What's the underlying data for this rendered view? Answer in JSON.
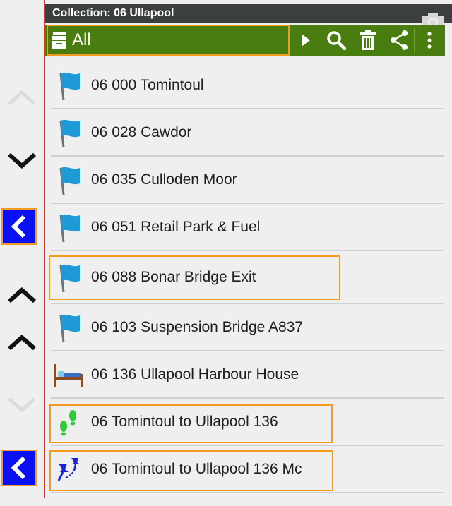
{
  "titlebar": {
    "title": "Collection: 06 Ullapool"
  },
  "toolbar": {
    "filter_label": "All",
    "icons": [
      "archive-icon",
      "play-icon",
      "search-icon",
      "trash-icon",
      "share-icon",
      "overflow-menu-icon"
    ]
  },
  "rail": {
    "buttons": [
      "chevron-up-icon",
      "chevron-down-icon",
      "chevron-left-icon",
      "chevron-up-icon",
      "chevron-up-icon",
      "chevron-down-icon",
      "chevron-left-icon"
    ]
  },
  "items": [
    {
      "label": "06 000 Tomintoul",
      "icon": "flag-icon"
    },
    {
      "label": "06 028 Cawdor",
      "icon": "flag-icon"
    },
    {
      "label": "06 035 Culloden Moor",
      "icon": "flag-icon"
    },
    {
      "label": "06 051 Retail Park & Fuel",
      "icon": "flag-icon"
    },
    {
      "label": "06 088 Bonar Bridge Exit",
      "icon": "flag-icon"
    },
    {
      "label": "06 103 Suspension Bridge A837",
      "icon": "flag-icon"
    },
    {
      "label": "06 136 Ullapool Harbour House",
      "icon": "bed-icon"
    },
    {
      "label": "06 Tomintoul to Ullapool 136",
      "icon": "footprints-icon"
    },
    {
      "label": "06 Tomintoul to Ullapool 136 Mc",
      "icon": "route-pins-icon"
    }
  ],
  "colors": {
    "toolbar": "#4a7d10",
    "titlebar": "#3c3f40",
    "highlight": "#f59a1e",
    "rail_button": "#0a10f2",
    "flag": "#1e9bd7"
  }
}
